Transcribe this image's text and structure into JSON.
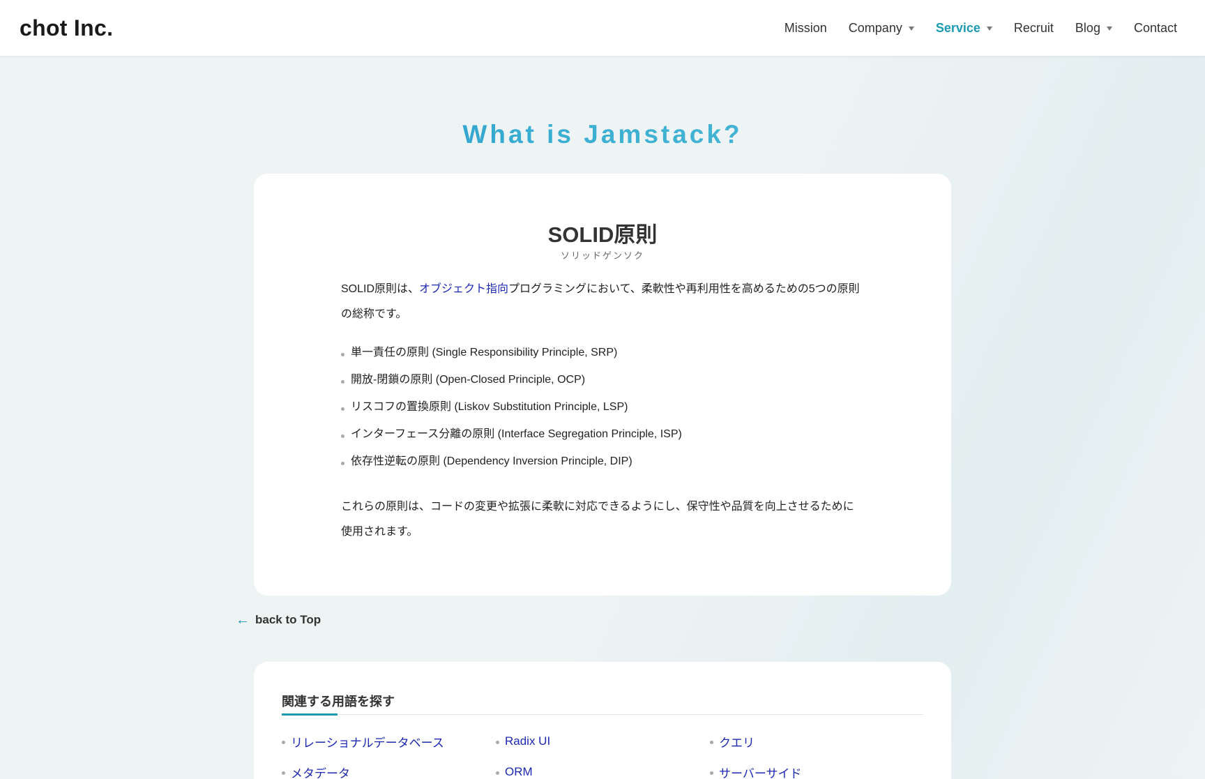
{
  "header": {
    "logo": "chot Inc.",
    "nav": [
      {
        "label": "Mission"
      },
      {
        "label": "Company"
      },
      {
        "label": "Service"
      },
      {
        "label": "Recruit"
      },
      {
        "label": "Blog"
      },
      {
        "label": "Contact"
      }
    ]
  },
  "hero": {
    "title": "What is Jamstack?"
  },
  "term": {
    "title": "SOLID原則",
    "reading": "ソリッドゲンソク",
    "intro_before": "SOLID原則は、",
    "intro_link": "オブジェクト指向",
    "intro_after": "プログラミングにおいて、柔軟性や再利用性を高めるための5つの原則の総称です。",
    "principles": [
      "単一責任の原則 (Single Responsibility Principle, SRP)",
      "開放-閉鎖の原則 (Open-Closed Principle, OCP)",
      "リスコフの置換原則 (Liskov Substitution Principle, LSP)",
      "インターフェース分離の原則 (Interface Segregation Principle, ISP)",
      "依存性逆転の原則 (Dependency Inversion Principle, DIP)"
    ],
    "closing": "これらの原則は、コードの変更や拡張に柔軟に対応できるようにし、保守性や品質を向上させるために使用されます。"
  },
  "back_link": {
    "label": "back to Top",
    "icon": "arrow-left-icon"
  },
  "related": {
    "title": "関連する用語を探す",
    "items": [
      {
        "label": "リレーショナルデータベース"
      },
      {
        "label": "Radix UI"
      },
      {
        "label": "クエリ"
      },
      {
        "label": "メタデータ"
      },
      {
        "label": "ORM"
      },
      {
        "label": "サーバーサイド"
      }
    ]
  },
  "colors": {
    "accent": "#1a9bb3",
    "link": "#1c28b3",
    "title_gradient_start": "#1579bf",
    "title_gradient_end": "#5bc0d6"
  }
}
